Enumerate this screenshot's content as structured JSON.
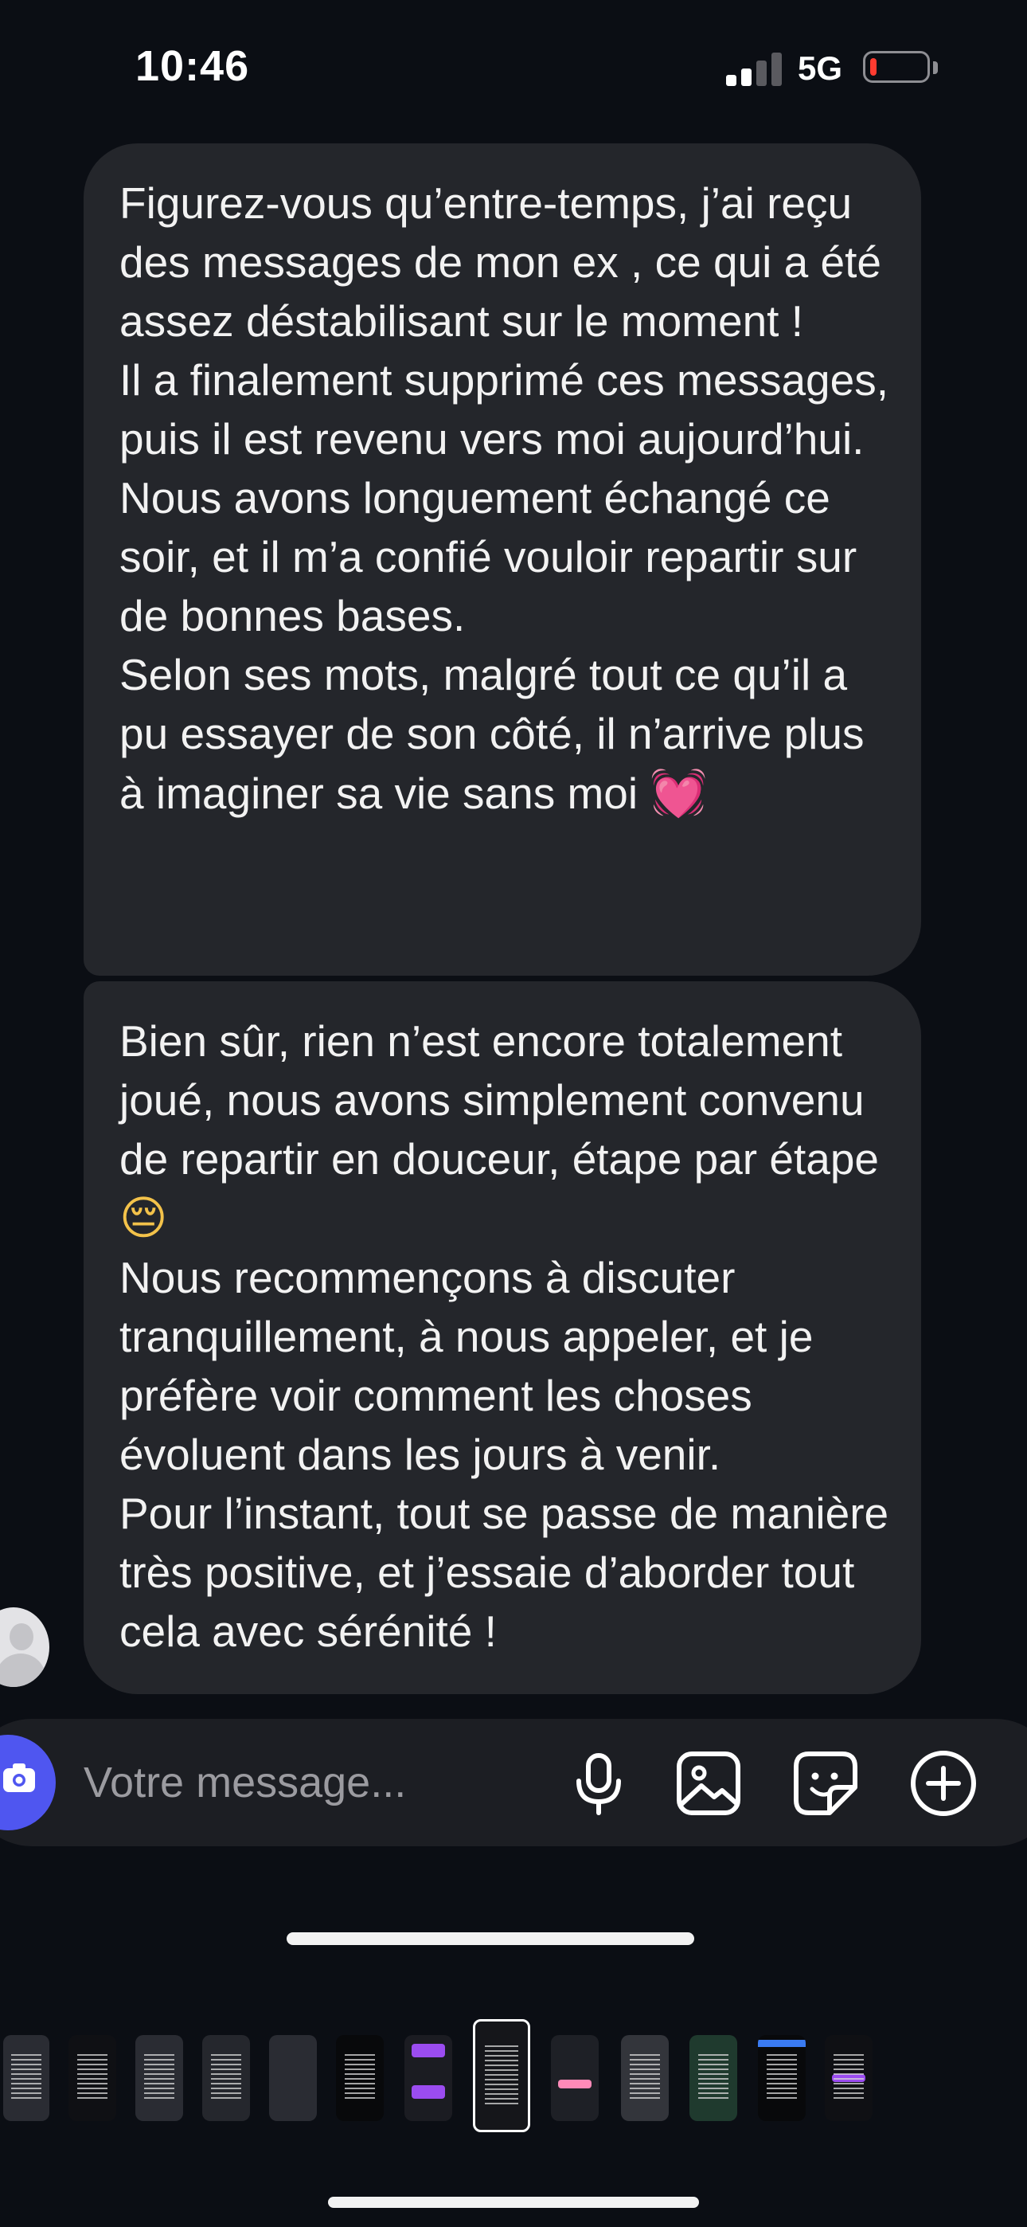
{
  "status_bar": {
    "time": "10:46",
    "network": "5G",
    "battery_level": 0.1,
    "signal_bars": 2,
    "battery_color": "#ff3b30"
  },
  "messages": [
    {
      "paragraphs": [
        "Figurez-vous qu’entre-temps, j’ai reçu des messages de mon ex , ce qui a été assez déstabilisant sur le moment !",
        "Il a finalement supprimé ces messages, puis il est revenu vers moi aujourd’hui. Nous avons longuement échangé ce soir, et il m’a confié vouloir repartir sur de bonnes bases.",
        "Selon ses mots, malgré tout ce qu’il a pu essayer de son côté, il n’arrive plus à imaginer sa vie sans moi"
      ],
      "emoji": "💓"
    },
    {
      "paragraphs": [
        "Bien sûr, rien n’est encore totalement joué, nous avons simplement convenu de repartir en douceur, étape par étape",
        "Nous recommençons à discuter tranquillement, à nous appeler, et je préfère voir comment les choses évoluent dans les jours à venir.",
        "Pour l’instant, tout se passe de manière très positive, et j’essaie d’aborder tout cela avec sérénité !"
      ],
      "emoji": "😔"
    }
  ],
  "composer": {
    "placeholder": "Votre message...",
    "icons": [
      "camera-icon",
      "microphone-icon",
      "image-icon",
      "sticker-icon",
      "plus-icon"
    ],
    "accent_color": "#4f56f0"
  },
  "thumbnails": [
    {
      "style": "dark-text"
    },
    {
      "style": "black-text"
    },
    {
      "style": "dark-text"
    },
    {
      "style": "dark-text"
    },
    {
      "style": "dark"
    },
    {
      "style": "black-text"
    },
    {
      "style": "violet"
    },
    {
      "style": "selected-text"
    },
    {
      "style": "pink"
    },
    {
      "style": "dark-text"
    },
    {
      "style": "green"
    },
    {
      "style": "blue"
    },
    {
      "style": "violet-small"
    }
  ]
}
